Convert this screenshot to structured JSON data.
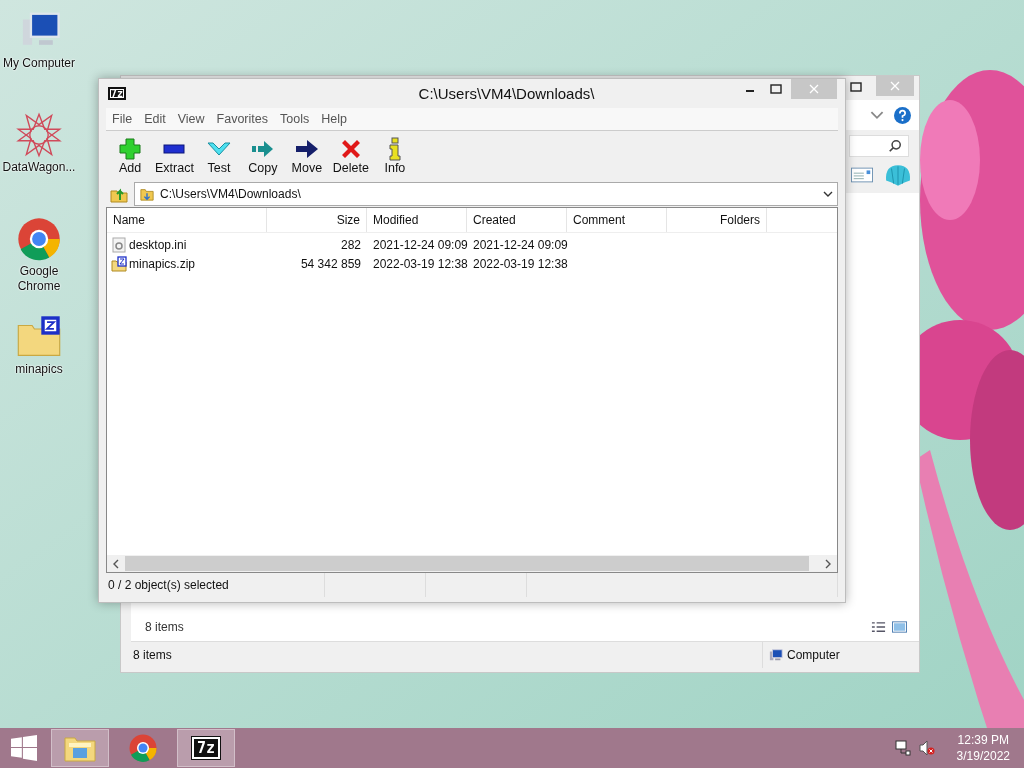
{
  "desktop_icons": [
    {
      "label": "My Computer",
      "kind": "computer"
    },
    {
      "label": "DataWagon...",
      "kind": "star"
    },
    {
      "label": "Google Chrome",
      "kind": "chrome"
    },
    {
      "label": "minapics",
      "kind": "zipfolder"
    }
  ],
  "explorer": {
    "footer_count": "8 items",
    "status_count": "8 items",
    "location": "Computer"
  },
  "archiver": {
    "logo": "7z",
    "title": "C:\\Users\\VM4\\Downloads\\",
    "menu": [
      "File",
      "Edit",
      "View",
      "Favorites",
      "Tools",
      "Help"
    ],
    "toolbar": [
      {
        "label": "Add",
        "kind": "add"
      },
      {
        "label": "Extract",
        "kind": "extract"
      },
      {
        "label": "Test",
        "kind": "test"
      },
      {
        "label": "Copy",
        "kind": "copy"
      },
      {
        "label": "Move",
        "kind": "move"
      },
      {
        "label": "Delete",
        "kind": "delete"
      },
      {
        "label": "Info",
        "kind": "info"
      }
    ],
    "path": "C:\\Users\\VM4\\Downloads\\",
    "columns": [
      "Name",
      "Size",
      "Modified",
      "Created",
      "Comment",
      "Folders"
    ],
    "rows": [
      {
        "kind": "settings",
        "cells": [
          "desktop.ini",
          "282",
          "2021-12-24 09:09",
          "2021-12-24 09:09"
        ]
      },
      {
        "kind": "zip",
        "cells": [
          "minapics.zip",
          "54 342 859",
          "2022-03-19 12:38",
          "2022-03-19 12:38"
        ]
      }
    ],
    "status": "0 / 2 object(s) selected"
  },
  "taskbar": {
    "apps": [
      {
        "kind": "explorer",
        "selected": true
      },
      {
        "kind": "chrome",
        "selected": false
      },
      {
        "kind": "sevenzip",
        "label": "7z",
        "selected": true
      }
    ],
    "time": "12:39 PM",
    "date": "3/19/2022"
  }
}
